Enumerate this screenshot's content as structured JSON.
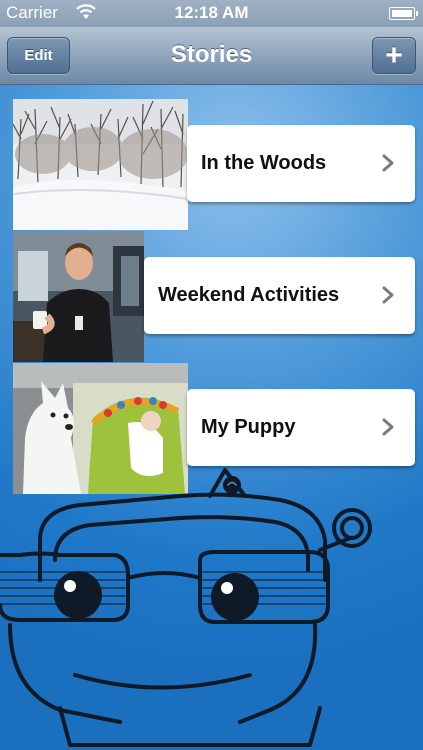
{
  "status_bar": {
    "carrier": "Carrier",
    "time": "12:18 AM"
  },
  "nav": {
    "title": "Stories",
    "edit_label": "Edit",
    "add_label": "+"
  },
  "stories": [
    {
      "title": "In the Woods"
    },
    {
      "title": "Weekend Activities"
    },
    {
      "title": "My Puppy"
    }
  ],
  "colors": {
    "background": "#1f78c8",
    "nav_bar": "#8fa5bc",
    "card": "#ffffff"
  }
}
